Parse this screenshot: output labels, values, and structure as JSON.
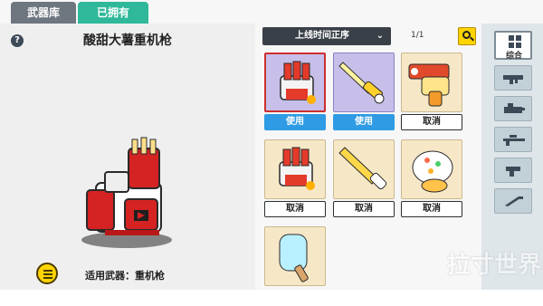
{
  "tabs": [
    {
      "label": "武器库",
      "active": true
    },
    {
      "label": "已拥有",
      "active": false
    }
  ],
  "left_panel": {
    "help_symbol": "?",
    "weapon_name": "酸甜大薯重机枪",
    "applicable_weapon": "适用武器：重机枪"
  },
  "toolbar": {
    "sort_label": "上线时间正序",
    "page_info": "1/1"
  },
  "grid": {
    "items": [
      {
        "name": "red-white-claw-skin",
        "action": "使用",
        "action_type": "use",
        "highlight": "purple-selected"
      },
      {
        "name": "golden-sword-skin",
        "action": "使用",
        "action_type": "use",
        "highlight": "purple"
      },
      {
        "name": "orange-pistol-skin",
        "action": "取消",
        "action_type": "cancel",
        "highlight": "normal"
      },
      {
        "name": "claw-gauntlet-skin",
        "action": "取消",
        "action_type": "cancel",
        "highlight": "normal"
      },
      {
        "name": "golden-blade-skin",
        "action": "取消",
        "action_type": "cancel",
        "highlight": "normal"
      },
      {
        "name": "ice-cream-blob-skin",
        "action": "取消",
        "action_type": "cancel",
        "highlight": "normal"
      },
      {
        "name": "popsicle-skin",
        "action": "",
        "action_type": "none",
        "highlight": "normal"
      }
    ]
  },
  "categories": [
    {
      "label": "综合",
      "icon": "grid-icon",
      "selected": true
    },
    {
      "label": "",
      "icon": "rifle-icon",
      "selected": false
    },
    {
      "label": "",
      "icon": "heavy-gun-icon",
      "selected": false
    },
    {
      "label": "",
      "icon": "sniper-icon",
      "selected": false
    },
    {
      "label": "",
      "icon": "pistol-icon",
      "selected": false
    },
    {
      "label": "",
      "icon": "knife-icon",
      "selected": false
    }
  ],
  "watermark": "拉寸世界",
  "colors": {
    "tab_active": "#6e7680",
    "tab_inactive": "#2fb89a",
    "use_button": "#2f9be4",
    "accent_yellow": "#ffd400"
  }
}
